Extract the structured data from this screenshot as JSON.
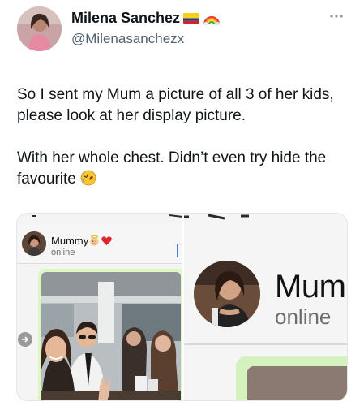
{
  "tweet": {
    "author_name": "Milena Sanchez",
    "handle": "@Milenasanchezx",
    "paragraph1": "So I sent my Mum a picture of all 3 of her kids, please look at her display picture.",
    "paragraph2": "With her whole chest. Didn’t even try hide the favourite",
    "icons": {
      "name_badges": [
        "colombia-flag-icon",
        "rainbow-icon"
      ],
      "menu": "more-icon",
      "text_emoji": "rolling-on-floor-laughing-emoji"
    }
  },
  "media": {
    "left_panel": {
      "contact_name": "Mummy",
      "contact_emojis": [
        "baby-angel-emoji",
        "red-heart-emoji"
      ],
      "contact_status": "online"
    },
    "right_panel": {
      "contact_name": "Mum",
      "contact_status": "online"
    }
  },
  "colors": {
    "text_primary": "#0f1419",
    "text_secondary": "#536471",
    "chat_bubble": "#dcf6c6"
  }
}
